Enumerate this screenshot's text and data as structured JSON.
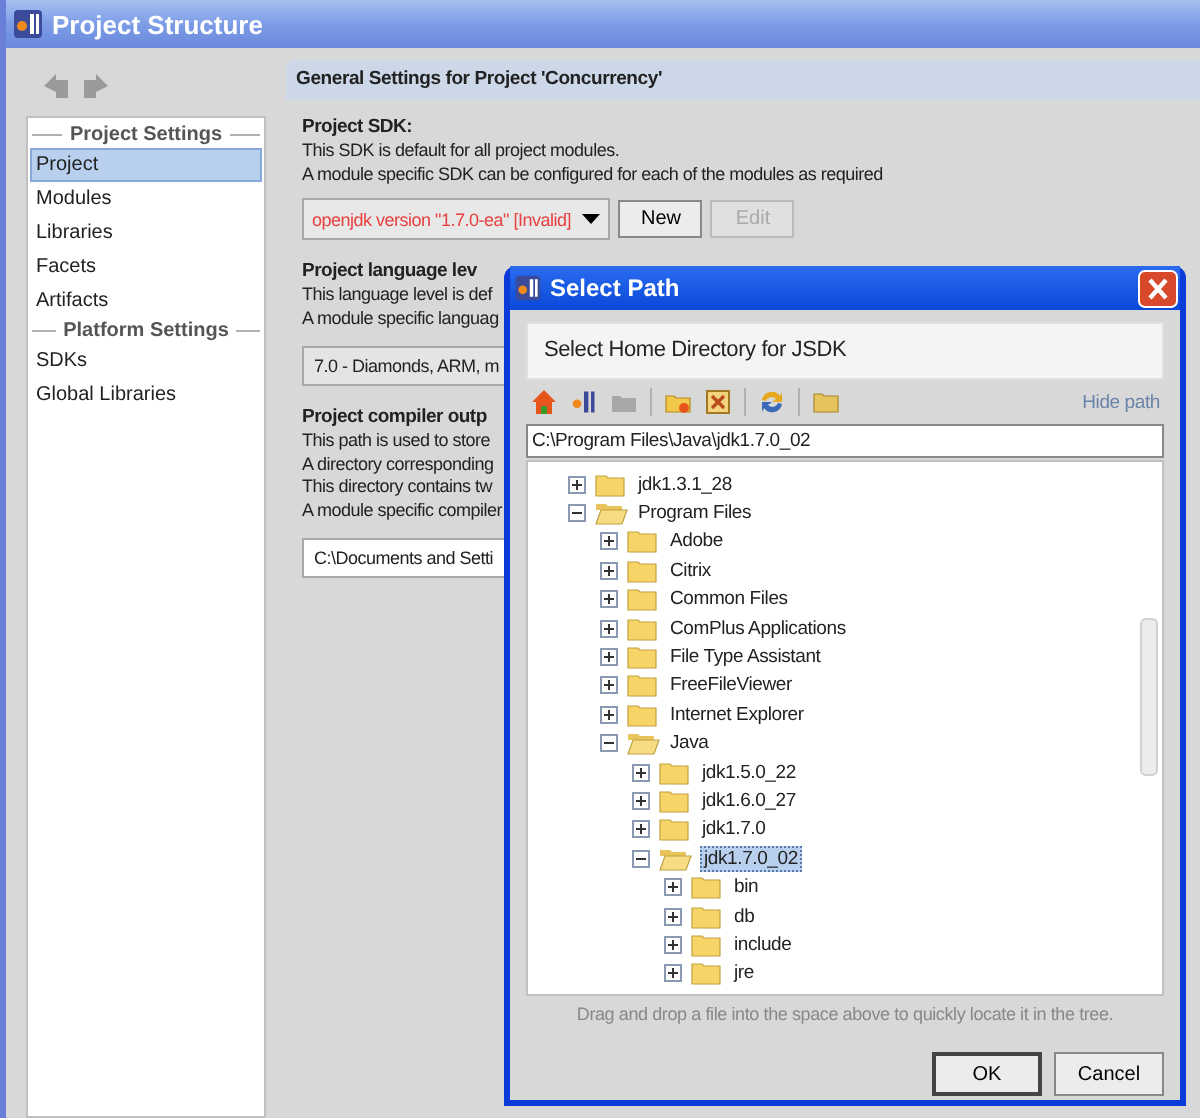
{
  "window": {
    "title": "Project Structure"
  },
  "sidebar": {
    "sections": [
      {
        "title": "Project Settings",
        "items": [
          {
            "label": "Project",
            "selected": true
          },
          {
            "label": "Modules",
            "selected": false
          },
          {
            "label": "Libraries",
            "selected": false
          },
          {
            "label": "Facets",
            "selected": false
          },
          {
            "label": "Artifacts",
            "selected": false
          }
        ]
      },
      {
        "title": "Platform Settings",
        "items": [
          {
            "label": "SDKs",
            "selected": false
          },
          {
            "label": "Global Libraries",
            "selected": false
          }
        ]
      }
    ]
  },
  "panel": {
    "title": "General Settings for Project 'Concurrency'",
    "sdk": {
      "heading": "Project SDK:",
      "lines": [
        "This SDK is default for all project modules.",
        "A module specific SDK can be configured for each of the modules as required"
      ],
      "value": "openjdk version \"1.7.0-ea\" [Invalid]",
      "invalid": true,
      "buttons": [
        {
          "label": "New",
          "disabled": false
        },
        {
          "label": "Edit",
          "disabled": true
        }
      ]
    },
    "language": {
      "heading": "Project language lev",
      "lines": [
        "This language level is def",
        "A module specific languag"
      ],
      "value": "7.0 - Diamonds, ARM, m"
    },
    "compiler": {
      "heading": "Project compiler outp",
      "lines": [
        "This path is used to store",
        "A directory corresponding",
        "This directory contains tw",
        "A module specific compiler"
      ],
      "value": "C:\\Documents and Setti"
    }
  },
  "dialog": {
    "title": "Select Path",
    "header": "Select Home Directory for JSDK",
    "hide_path": "Hide path",
    "path": "C:\\Program Files\\Java\\jdk1.7.0_02",
    "tree": [
      {
        "label": "jdk1.3.1_28",
        "expanded": false,
        "selected": false
      },
      {
        "label": "Program Files",
        "expanded": true,
        "selected": false,
        "children": [
          {
            "label": "Adobe",
            "expanded": false,
            "selected": false
          },
          {
            "label": "Citrix",
            "expanded": false,
            "selected": false
          },
          {
            "label": "Common Files",
            "expanded": false,
            "selected": false
          },
          {
            "label": "ComPlus Applications",
            "expanded": false,
            "selected": false
          },
          {
            "label": "File Type Assistant",
            "expanded": false,
            "selected": false
          },
          {
            "label": "FreeFileViewer",
            "expanded": false,
            "selected": false
          },
          {
            "label": "Internet Explorer",
            "expanded": false,
            "selected": false
          },
          {
            "label": "Java",
            "expanded": true,
            "selected": false,
            "children": [
              {
                "label": "jdk1.5.0_22",
                "expanded": false,
                "selected": false
              },
              {
                "label": "jdk1.6.0_27",
                "expanded": false,
                "selected": false
              },
              {
                "label": "jdk1.7.0",
                "expanded": false,
                "selected": false
              },
              {
                "label": "jdk1.7.0_02",
                "expanded": true,
                "selected": true,
                "children": [
                  {
                    "label": "bin",
                    "expanded": false,
                    "selected": false
                  },
                  {
                    "label": "db",
                    "expanded": false,
                    "selected": false
                  },
                  {
                    "label": "include",
                    "expanded": false,
                    "selected": false
                  },
                  {
                    "label": "jre",
                    "expanded": false,
                    "selected": false
                  }
                ]
              }
            ]
          }
        ]
      }
    ],
    "hint": "Drag and drop a file into the space above to quickly locate it in the tree.",
    "buttons": [
      "OK",
      "Cancel"
    ]
  }
}
